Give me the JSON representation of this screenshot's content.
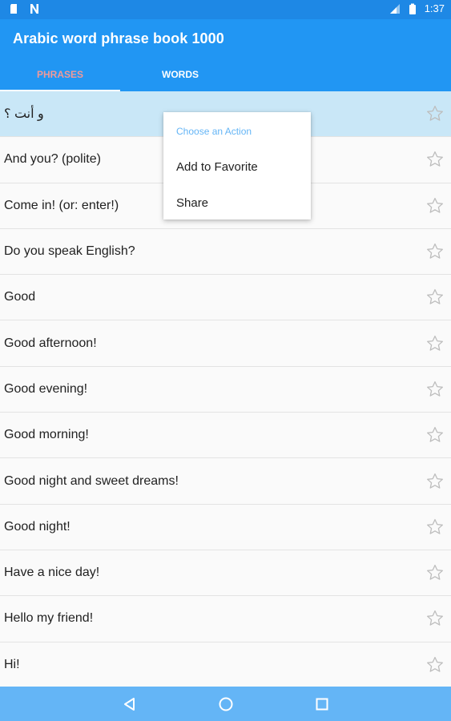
{
  "status_bar": {
    "time": "1:37",
    "icons": [
      "sd-card-icon",
      "notification-n-icon",
      "signal-icon",
      "battery-icon"
    ]
  },
  "app_bar": {
    "title": "Arabic word phrase book 1000",
    "tabs": [
      {
        "label": "PHRASES",
        "selected": true
      },
      {
        "label": "WORDS",
        "selected": false
      }
    ]
  },
  "phrases": [
    {
      "text": "و أنت ؟",
      "favorite": false,
      "highlighted": true
    },
    {
      "text": "And you? (polite)",
      "favorite": false,
      "highlighted": false
    },
    {
      "text": "Come in! (or: enter!)",
      "favorite": false,
      "highlighted": false
    },
    {
      "text": "Do you speak English?",
      "favorite": false,
      "highlighted": false
    },
    {
      "text": "Good",
      "favorite": false,
      "highlighted": false
    },
    {
      "text": "Good afternoon!",
      "favorite": false,
      "highlighted": false
    },
    {
      "text": "Good evening!",
      "favorite": false,
      "highlighted": false
    },
    {
      "text": "Good morning!",
      "favorite": false,
      "highlighted": false
    },
    {
      "text": "Good night and sweet dreams!",
      "favorite": false,
      "highlighted": false
    },
    {
      "text": "Good night!",
      "favorite": false,
      "highlighted": false
    },
    {
      "text": "Have a nice day!",
      "favorite": false,
      "highlighted": false
    },
    {
      "text": "Hello my friend!",
      "favorite": false,
      "highlighted": false
    },
    {
      "text": "Hi!",
      "favorite": false,
      "highlighted": false
    }
  ],
  "context_menu": {
    "header": "Choose an Action",
    "items": [
      "Add to Favorite",
      "Share"
    ]
  },
  "nav_bar": {
    "buttons": [
      "back-icon",
      "home-icon",
      "recents-icon"
    ]
  },
  "colors": {
    "primary": "#2196f3",
    "status_bar": "#1e88e5",
    "nav_bar": "#64b5f6",
    "selected_tab": "#ef9a9a",
    "highlight_row": "#c9e7f7",
    "menu_header": "#64b5f6"
  }
}
